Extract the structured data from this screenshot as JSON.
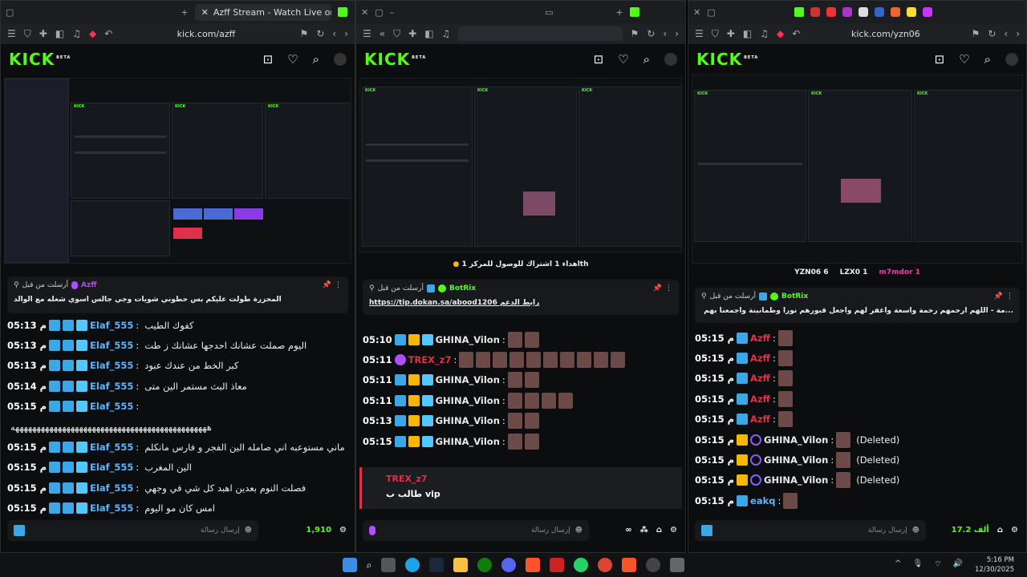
{
  "windows": [
    {
      "tab_title": "Azff Stream - Watch Live on Kick",
      "url": "kick.com/azff",
      "pinned": {
        "header": "أرسلت من قبل",
        "author": "Azff",
        "text": "المحزرة طولت عليكم بس حطوني شويات وجي جالس اسوي شغله مع الوالد"
      },
      "messages": [
        {
          "time": "05:13 م",
          "user": "Elaf_555",
          "text": "كفوك الطيب"
        },
        {
          "time": "05:13 م",
          "user": "Elaf_555",
          "text": "اليوم صملت عشانك احدجها عشانك ز طت"
        },
        {
          "time": "05:13 م",
          "user": "Elaf_555",
          "text": "كبر الخط من عندك عبود"
        },
        {
          "time": "05:14 م",
          "user": "Elaf_555",
          "text": "معاذ البث مستمر الين متى"
        },
        {
          "time": "05:15 م",
          "user": "Elaf_555",
          "text": ""
        },
        {
          "time": "",
          "user": "",
          "text": "ههههههههههههههههههههههههههههههههههههههههههههههه"
        },
        {
          "time": "05:15 م",
          "user": "Elaf_555",
          "text": "ماني مستوعبه اني صامله الين الفجر و فارس مانكلم"
        },
        {
          "time": "05:15 م",
          "user": "Elaf_555",
          "text": "الين المغرب"
        },
        {
          "time": "05:15 م",
          "user": "Elaf_555",
          "text": "فصلت النوم بعدين اهبد كل شي في وجهي"
        },
        {
          "time": "05:15 م",
          "user": "Elaf_555",
          "text": "امس كان مو اليوم"
        }
      ],
      "input_placeholder": "إرسال رسالة",
      "viewers": "1,910"
    },
    {
      "tab_title": "",
      "url": "",
      "sub_goal": "اهداء 1 اشتراك للوصول للمركز 1",
      "sub_suffix": "th",
      "pinned": {
        "header": "أرسلت من قبل",
        "author": "BotRix",
        "text": "رابط الدعم https://tip.dokan.sa/abood1206"
      },
      "messages": [
        {
          "time": "05:10",
          "user": "GHINA_Vilon",
          "text": ""
        },
        {
          "time": "05:11",
          "user": "TREX_z7",
          "text": ""
        },
        {
          "time": "05:11",
          "user": "GHINA_Vilon",
          "text": ""
        },
        {
          "time": "05:11",
          "user": "GHINA_Vilon",
          "text": ""
        },
        {
          "time": "05:13",
          "user": "GHINA_Vilon",
          "text": ""
        },
        {
          "time": "05:15",
          "user": "GHINA_Vilon",
          "text": ""
        }
      ],
      "reply": {
        "user": "TREX_z7",
        "text": "طالب ب vip"
      },
      "input_placeholder": "إرسال رسالة"
    },
    {
      "tab_title": "",
      "url": "kick.com/yzn06",
      "gifters": [
        "YZN06 6",
        "LZX0 1",
        "m7mdor 1"
      ],
      "pinned": {
        "header": "أرسلت من قبل",
        "author": "BotRix",
        "text": "...مة - اللهم ارحمهم رحمة واسعة واغفر لهم واجعل قبورهم نورا وطمأنينة واجمعنا بهم في جنتك بلا حساب ولا عذاب"
      },
      "messages": [
        {
          "time": "05:15 م",
          "user": "Azff",
          "text": ""
        },
        {
          "time": "05:15 م",
          "user": "Azff",
          "text": ""
        },
        {
          "time": "05:15 م",
          "user": "Azff",
          "text": ""
        },
        {
          "time": "05:15 م",
          "user": "Azff",
          "text": ""
        },
        {
          "time": "05:15 م",
          "user": "Azff",
          "text": ""
        },
        {
          "time": "05:15 م",
          "user": "GHINA_Vilon",
          "text": "(Deleted)"
        },
        {
          "time": "05:15 م",
          "user": "GHINA_Vilon",
          "text": "(Deleted)"
        },
        {
          "time": "05:15 م",
          "user": "GHINA_Vilon",
          "text": "(Deleted)"
        },
        {
          "time": "05:15 م",
          "user": "eakq",
          "text": ""
        }
      ],
      "input_placeholder": "إرسال رسالة",
      "viewers": "17.2 ألف"
    }
  ],
  "kick_logo": "KICK",
  "kick_beta": "BETA",
  "clock": {
    "time": "5:16 PM",
    "date": "12/30/2025"
  },
  "colors": {
    "kick_green": "#53fc18",
    "user_blue": "#5bb4ff",
    "user_red": "#e0304a"
  }
}
